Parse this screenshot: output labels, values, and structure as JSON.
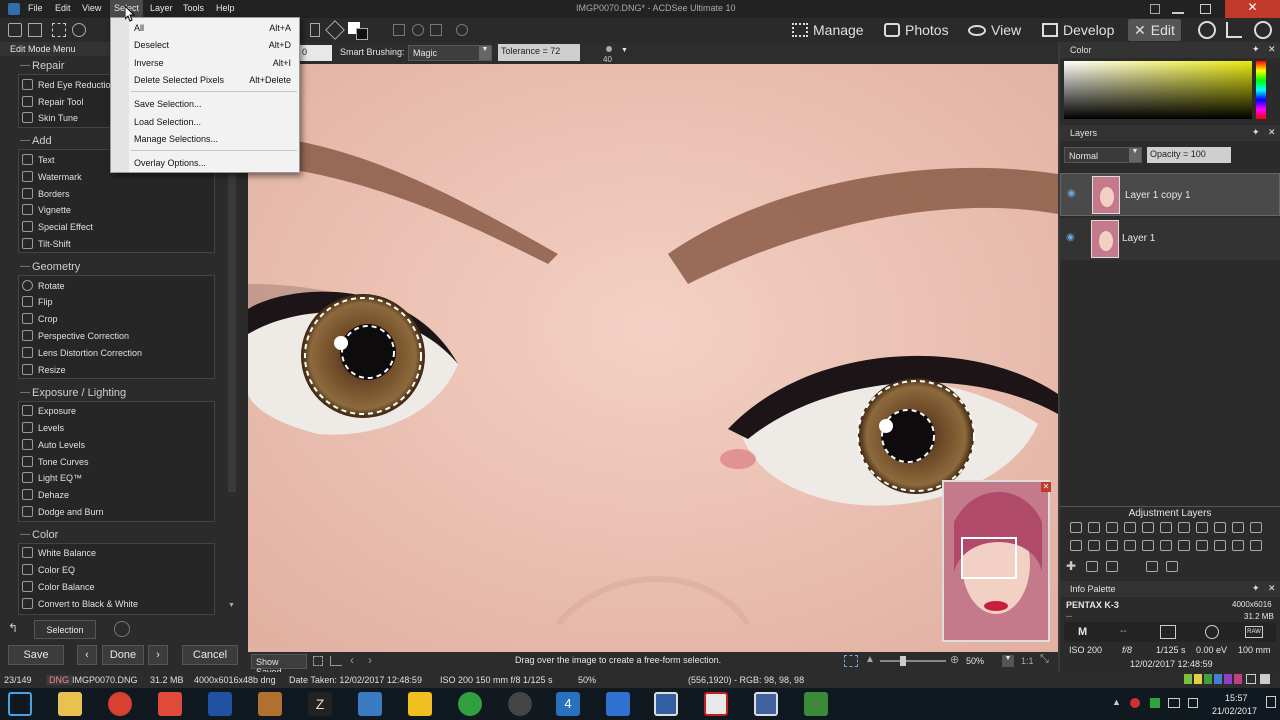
{
  "window": {
    "title": "IMGP0070.DNG* - ACDSee Ultimate 10"
  },
  "menu": {
    "file": "File",
    "edit": "Edit",
    "view": "View",
    "select": "Select",
    "layer": "Layer",
    "tools": "Tools",
    "help": "Help"
  },
  "modes": {
    "manage": "Manage",
    "photos": "Photos",
    "view": "View",
    "develop": "Develop",
    "edit": "Edit"
  },
  "options_bar": {
    "size_value": "0",
    "smart_brushing_label": "Smart Brushing:",
    "smart_brushing_value": "Magic",
    "tolerance": "Tolerance = 72",
    "brush_size": "40"
  },
  "select_menu": {
    "items": [
      {
        "label": "All",
        "shortcut": "Alt+A"
      },
      {
        "label": "Deselect",
        "shortcut": "Alt+D"
      },
      {
        "label": "Inverse",
        "shortcut": "Alt+I"
      },
      {
        "label": "Delete Selected Pixels",
        "shortcut": "Alt+Delete"
      },
      {
        "label": "Save Selection...",
        "shortcut": ""
      },
      {
        "label": "Load Selection...",
        "shortcut": ""
      },
      {
        "label": "Manage Selections...",
        "shortcut": ""
      },
      {
        "label": "Overlay Options...",
        "shortcut": ""
      }
    ]
  },
  "left_panel": {
    "title": "Edit Mode Menu",
    "sections": [
      {
        "title": "Repair",
        "tools": [
          "Red Eye Reduction",
          "Repair Tool",
          "Skin Tune"
        ]
      },
      {
        "title": "Add",
        "tools": [
          "Text",
          "Watermark",
          "Borders",
          "Vignette",
          "Special Effect",
          "Tilt-Shift"
        ]
      },
      {
        "title": "Geometry",
        "tools": [
          "Rotate",
          "Flip",
          "Crop",
          "Perspective Correction",
          "Lens Distortion Correction",
          "Resize"
        ]
      },
      {
        "title": "Exposure / Lighting",
        "tools": [
          "Exposure",
          "Levels",
          "Auto Levels",
          "Tone Curves",
          "Light EQ™",
          "Dehaze",
          "Dodge and Burn"
        ]
      },
      {
        "title": "Color",
        "tools": [
          "White Balance",
          "Color EQ",
          "Color Balance",
          "Convert to Black & White"
        ]
      }
    ],
    "selection_button": "Selection",
    "save": "Save",
    "done": "Done",
    "cancel": "Cancel"
  },
  "canvas_footer": {
    "show_saved": "Show Saved",
    "hint": "Drag over the image to create a free-form selection.",
    "coords": "(556,1920) - RGB: 98, 98, 98",
    "zoom": "50%",
    "ratio": "1:1"
  },
  "right_panel": {
    "color_title": "Color",
    "layers_title": "Layers",
    "blend_mode": "Normal",
    "opacity": "Opacity = 100",
    "layers": [
      "Layer 1 copy 1",
      "Layer 1"
    ],
    "adjustment_layers_title": "Adjustment Layers",
    "info_title": "Info Palette",
    "camera": "PENTAX K-3",
    "dimensions": "4000x6016",
    "filesize": "31.2 MB",
    "dash": "--",
    "mode": "M",
    "mode_dash": "--",
    "iso": "ISO 200",
    "aperture": "f/8",
    "shutter": "1/125 s",
    "ev": "0.00 eV",
    "focal": "100 mm",
    "date": "12/02/2017 12:48:59",
    "raw": "RAW"
  },
  "status_bar": {
    "count": "23/149",
    "format": "DNG",
    "filename": "IMGP0070.DNG",
    "size": "31.2 MB",
    "dims": "4000x6016x48b dng",
    "date_taken": "Date Taken: 12/02/2017 12:48:59",
    "exif": "ISO 200   150 mm   f/8   1/125 s",
    "zoom": "50%",
    "pixel": "(556,1920) - RGB: 98, 98, 98"
  },
  "taskbar": {
    "time": "15:57",
    "date": "21/02/2017",
    "calendar_day": "4"
  }
}
